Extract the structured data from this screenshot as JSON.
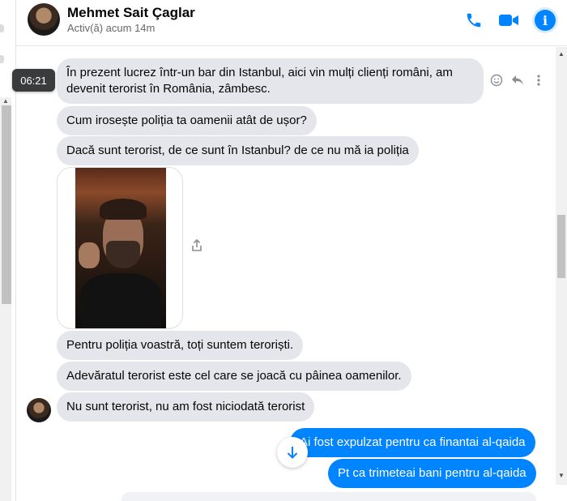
{
  "header": {
    "contact_name": "Mehmet Sait Çaglar",
    "status": "Activ(ă) acum 14m",
    "icons": [
      "phone-icon",
      "video-camera-icon",
      "info-icon"
    ],
    "info_glyph": "i"
  },
  "colors": {
    "accent": "#0084ff",
    "incoming_bubble": "#e4e6eb",
    "timestamp_bg": "#3a3b3c"
  },
  "timestamp": "06:21",
  "messages": [
    {
      "direction": "in",
      "text_line1": "În prezent lucrez într-un bar din Istanbul, aici vin mulți clienți români, am",
      "text_line2": "devenit terorist în România, zâmbesc."
    },
    {
      "direction": "in",
      "text": "Cum irosește poliția ta oamenii atât de ușor?"
    },
    {
      "direction": "in",
      "text": "Dacă sunt terorist, de ce sunt în Istanbul?  de ce nu mă ia poliția"
    },
    {
      "direction": "in",
      "type": "photo"
    },
    {
      "direction": "in",
      "text": "Pentru poliția voastră, toți suntem teroriști."
    },
    {
      "direction": "in",
      "text": "Adevăratul terorist este cel care se joacă cu pâinea oamenilor."
    },
    {
      "direction": "in",
      "text": "Nu sunt terorist, nu am fost niciodată terorist"
    },
    {
      "direction": "out",
      "text": "Ai fost expulzat pentru ca finantai al-qaida"
    },
    {
      "direction": "out",
      "text": "Pt ca trimeteai bani pentru al-qaida"
    }
  ],
  "message_actions": [
    "react-icon",
    "reply-icon",
    "more-icon"
  ]
}
